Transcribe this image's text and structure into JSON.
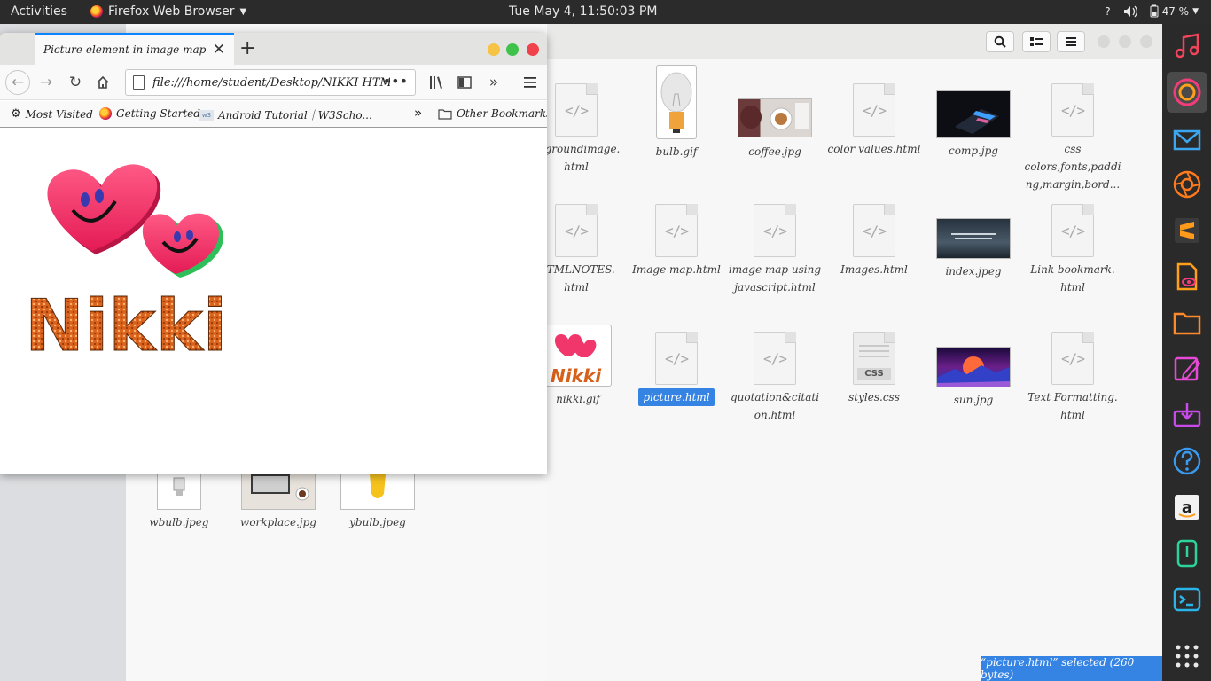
{
  "topbar": {
    "activities": "Activities",
    "app_name": "Firefox Web Browser",
    "clock": "Tue May  4, 11:50:03 PM",
    "help": "?",
    "battery": "47 %"
  },
  "browser": {
    "tab_title": "Picture element in image map",
    "url": "file:///home/student/Desktop/NIKKI HTML/picture.html",
    "bookmarks": [
      {
        "label": "Most Visited"
      },
      {
        "label": "Getting Started"
      },
      {
        "label": "Android Tutorial｜W3Scho..."
      }
    ],
    "other_bookmarks": "Other Bookmarks",
    "content_text": "Nikki"
  },
  "files": {
    "row1": [
      "ckgroundimage.\nhtml",
      "bulb.gif",
      "coffee.jpg",
      "color values.html",
      "comp.jpg",
      "css\ncolors,fonts,paddi\nng,margin,bord..."
    ],
    "row2": [
      "HTMLNOTES.\nhtml",
      "Image map.html",
      "image map using\njavascript.html",
      "Images.html",
      "index.jpeg",
      "Link bookmark.\nhtml"
    ],
    "row3": [
      "nikki.gif",
      "picture.html",
      "quotation&citati\non.html",
      "styles.css",
      "sun.jpg",
      "Text Formatting.\nhtml"
    ],
    "row4": [
      "wbulb.jpeg",
      "workplace.jpg",
      "ybulb.jpeg"
    ],
    "css_badge": "CSS"
  },
  "status": "“picture.html” selected  (260 bytes)",
  "colors": {
    "accent": "#3584e4",
    "topbar": "#2b2b2b",
    "dock": "#2a2a2a",
    "firefox_tab_accent": "#0a84ff"
  }
}
